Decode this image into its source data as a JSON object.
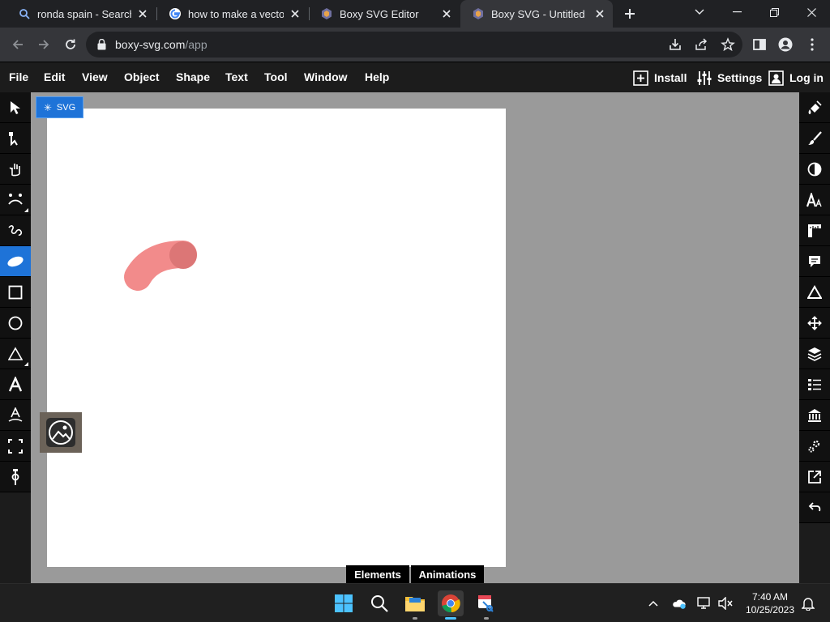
{
  "browser": {
    "tabs": [
      {
        "title": "ronda spain - Search",
        "icon": "search-icon"
      },
      {
        "title": "how to make a vector i",
        "icon": "google-icon"
      },
      {
        "title": "Boxy SVG Editor",
        "icon": "boxy-icon"
      },
      {
        "title": "Boxy SVG - Untitled [Ed",
        "icon": "boxy-icon",
        "active": true
      }
    ],
    "url_host": "boxy-svg.com",
    "url_path": "/app"
  },
  "menubar": {
    "items": [
      "File",
      "Edit",
      "View",
      "Object",
      "Shape",
      "Text",
      "Tool",
      "Window",
      "Help"
    ],
    "install_label": "Install",
    "settings_label": "Settings",
    "login_label": "Log in"
  },
  "canvas": {
    "badge_label": "SVG",
    "stroke_color": "#f28b8b",
    "stroke_end_color": "#dc7676"
  },
  "left_tools": [
    {
      "name": "select-tool",
      "icon": "arrow-icon"
    },
    {
      "name": "edit-tool",
      "icon": "node-arrow-icon"
    },
    {
      "name": "pan-tool",
      "icon": "hand-icon"
    },
    {
      "name": "warp-tool",
      "icon": "face-icon"
    },
    {
      "name": "pen-tool",
      "icon": "freehand-icon"
    },
    {
      "name": "paint-brush-tool",
      "icon": "brush-blob-icon",
      "selected": true
    },
    {
      "name": "rectangle-tool",
      "icon": "square-icon"
    },
    {
      "name": "ellipse-tool",
      "icon": "circle-icon"
    },
    {
      "name": "triangle-tool",
      "icon": "triangle-icon"
    },
    {
      "name": "text-tool",
      "icon": "text-a-icon"
    },
    {
      "name": "text-path-tool",
      "icon": "text-path-icon"
    },
    {
      "name": "crop-tool",
      "icon": "crop-icon"
    },
    {
      "name": "gradient-tool",
      "icon": "gradient-icon"
    }
  ],
  "right_tools": [
    "fill-icon",
    "brush-icon",
    "contrast-icon",
    "typography-icon",
    "ruler-icon",
    "comment-icon",
    "triangle-outline-icon",
    "move-icon",
    "layers-icon",
    "list-icon",
    "library-icon",
    "gears-icon",
    "export-icon",
    "undo-icon"
  ],
  "bottom_panels": {
    "elements_label": "Elements",
    "animations_label": "Animations"
  },
  "taskbar": {
    "time": "7:40 AM",
    "date": "10/25/2023"
  },
  "colors": {
    "accent": "#1e73d8",
    "workspace": "#9a9a9a",
    "toolbar": "#1c1c1c"
  }
}
